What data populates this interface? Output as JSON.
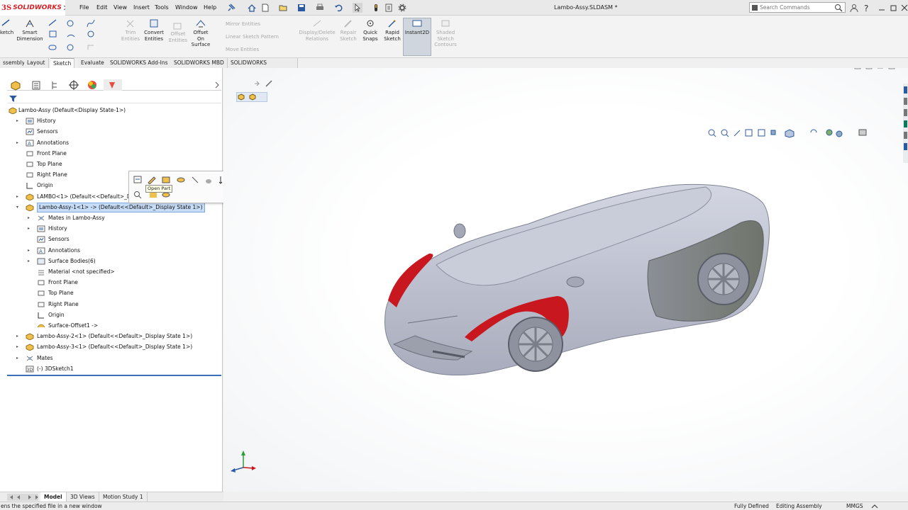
{
  "app": {
    "brand_prefix": "3S",
    "brand_name": "SOLIDWORKS",
    "doc_title": "Lambo-Assy.SLDASM *"
  },
  "menus": [
    "File",
    "Edit",
    "View",
    "Insert",
    "Tools",
    "Window",
    "Help"
  ],
  "search": {
    "placeholder": "Search Commands"
  },
  "ribbon": {
    "sketch": "ketch",
    "smart_dimension": [
      "Smart",
      "Dimension"
    ],
    "trim_entities": [
      "Trim",
      "Entities"
    ],
    "convert_entities": [
      "Convert",
      "Entities"
    ],
    "offset_entities": [
      "Offset",
      "Entities"
    ],
    "offset_on_surface": [
      "Offset",
      "On",
      "Surface"
    ],
    "mirror_entities": "Mirror Entities",
    "linear_sketch_pattern": "Linear Sketch Pattern",
    "move_entities": "Move Entities",
    "display_delete_relations": [
      "Display/Delete",
      "Relations"
    ],
    "repair_sketch": [
      "Repair",
      "Sketch"
    ],
    "quick_snaps": [
      "Quick",
      "Snaps"
    ],
    "rapid_sketch": [
      "Rapid",
      "Sketch"
    ],
    "instant2d": "Instant2D",
    "shaded_sketch_contours": [
      "Shaded",
      "Sketch",
      "Contours"
    ]
  },
  "tabs": [
    "ssembly",
    "Layout",
    "Sketch",
    "Evaluate",
    "SOLIDWORKS Add-Ins",
    "SOLIDWORKS MBD",
    "SOLIDWORKS Inspection"
  ],
  "active_tab": "Sketch",
  "tree": [
    {
      "label": "Lambo-Assy  (Default<Display State-1>)",
      "level": 0,
      "icon": "assembly-icon",
      "expander": ""
    },
    {
      "label": "History",
      "level": 1,
      "icon": "history-icon",
      "expander": "▸"
    },
    {
      "label": "Sensors",
      "level": 1,
      "icon": "sensors-icon",
      "expander": ""
    },
    {
      "label": "Annotations",
      "level": 1,
      "icon": "annotations-icon",
      "expander": "▸"
    },
    {
      "label": "Front Plane",
      "level": 1,
      "icon": "plane-icon",
      "expander": ""
    },
    {
      "label": "Top Plane",
      "level": 1,
      "icon": "plane-icon",
      "expander": ""
    },
    {
      "label": "Right Plane",
      "level": 1,
      "icon": "plane-icon",
      "expander": ""
    },
    {
      "label": "Origin",
      "level": 1,
      "icon": "origin-icon",
      "expander": ""
    },
    {
      "label": "LAMBO<1> (Default<<Default>_Displa",
      "level": 1,
      "icon": "part-icon",
      "expander": "▸"
    },
    {
      "label": "Lambo-Assy-1<1> -> (Default<<Default>_Display State 1>)",
      "level": 1,
      "icon": "part-icon",
      "expander": "▾",
      "selected": true
    },
    {
      "label": "Mates in Lambo-Assy",
      "level": 2,
      "icon": "mates-icon",
      "expander": "▸"
    },
    {
      "label": "History",
      "level": 2,
      "icon": "history-icon",
      "expander": "▸"
    },
    {
      "label": "Sensors",
      "level": 2,
      "icon": "sensors-icon",
      "expander": ""
    },
    {
      "label": "Annotations",
      "level": 2,
      "icon": "annotations-icon",
      "expander": "▸"
    },
    {
      "label": "Surface Bodies(6)",
      "level": 2,
      "icon": "surface-bodies-icon",
      "expander": "▸"
    },
    {
      "label": "Material <not specified>",
      "level": 2,
      "icon": "material-icon",
      "expander": ""
    },
    {
      "label": "Front Plane",
      "level": 2,
      "icon": "plane-icon",
      "expander": ""
    },
    {
      "label": "Top Plane",
      "level": 2,
      "icon": "plane-icon",
      "expander": ""
    },
    {
      "label": "Right Plane",
      "level": 2,
      "icon": "plane-icon",
      "expander": ""
    },
    {
      "label": "Origin",
      "level": 2,
      "icon": "origin-icon",
      "expander": ""
    },
    {
      "label": "Surface-Offset1 ->",
      "level": 2,
      "icon": "surface-offset-icon",
      "expander": ""
    },
    {
      "label": "Lambo-Assy-2<1> (Default<<Default>_Display State 1>)",
      "level": 1,
      "icon": "part-icon",
      "expander": "▸"
    },
    {
      "label": "Lambo-Assy-3<1> (Default<<Default>_Display State 1>)",
      "level": 1,
      "icon": "part-icon",
      "expander": "▸"
    },
    {
      "label": "Mates",
      "level": 1,
      "icon": "mates-icon",
      "expander": "▸"
    },
    {
      "label": "(-) 3DSketch1",
      "level": 1,
      "icon": "3dsketch-icon",
      "expander": ""
    }
  ],
  "tooltip": "Open Part",
  "bottom_tabs": [
    "Model",
    "3D Views",
    "Motion Study 1"
  ],
  "status": {
    "message": "ens the specified file in a new window",
    "defined": "Fully Defined",
    "mode": "Editing Assembly",
    "units": "MMGS"
  },
  "colors": {
    "accent": "#3b6fb6",
    "selection": "#c7ddf7",
    "body": "#c3c7d6",
    "highlight": "#c8171e",
    "brand": "#d42025"
  }
}
